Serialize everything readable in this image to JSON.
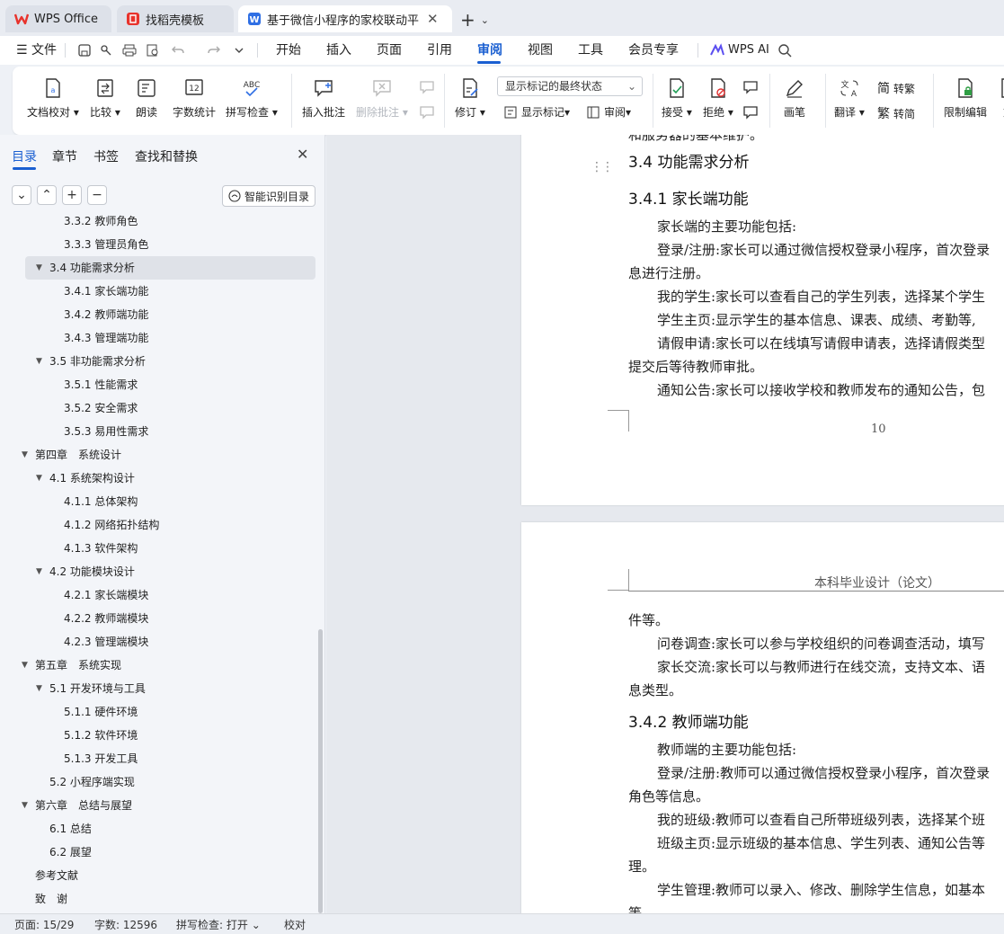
{
  "tabs": [
    {
      "label": "WPS Office",
      "icon": "wps-logo-icon"
    },
    {
      "label": "找稻壳模板",
      "icon": "docer-icon"
    },
    {
      "label": "基于微信小程序的家校联动平台",
      "icon": "word-doc-icon"
    }
  ],
  "menu": {
    "file_label": "文件",
    "items": [
      "开始",
      "插入",
      "页面",
      "引用",
      "审阅",
      "视图",
      "工具",
      "会员专享"
    ],
    "active": "审阅",
    "wps_ai_label": "WPS AI"
  },
  "ribbon": {
    "doc_check": "文档校对",
    "compare": "比较",
    "read_aloud": "朗读",
    "word_count": "字数统计",
    "spell_check": "拼写检查",
    "insert_comment": "插入批注",
    "delete_comment": "删除批注",
    "track_changes": "修订",
    "markup_state": "显示标记的最终状态",
    "show_markup": "显示标记",
    "review": "审阅",
    "accept": "接受",
    "reject": "拒绝",
    "ink": "画笔",
    "translate": "翻译",
    "to_traditional": "转繁",
    "to_simplified": "转简",
    "restrict_edit": "限制编辑",
    "cut_off": "文"
  },
  "nav": {
    "tabs": [
      "目录",
      "章节",
      "书签",
      "查找和替换"
    ],
    "smart_btn": "智能识别目录",
    "toc": [
      {
        "text": "3.3.2 教师角色",
        "level": 3
      },
      {
        "text": "3.3.3 管理员角色",
        "level": 3
      },
      {
        "text": "3.4 功能需求分析",
        "level": 2,
        "expanded": true,
        "selected": true
      },
      {
        "text": "3.4.1 家长端功能",
        "level": 3
      },
      {
        "text": "3.4.2 教师端功能",
        "level": 3
      },
      {
        "text": "3.4.3 管理端功能",
        "level": 3
      },
      {
        "text": "3.5 非功能需求分析",
        "level": 2,
        "expanded": true
      },
      {
        "text": "3.5.1 性能需求",
        "level": 3
      },
      {
        "text": "3.5.2 安全需求",
        "level": 3
      },
      {
        "text": "3.5.3 易用性需求",
        "level": 3
      },
      {
        "text": "第四章　系统设计",
        "level": 1,
        "expanded": true
      },
      {
        "text": "4.1 系统架构设计",
        "level": 2,
        "expanded": true
      },
      {
        "text": "4.1.1 总体架构",
        "level": 3
      },
      {
        "text": "4.1.2 网络拓扑结构",
        "level": 3
      },
      {
        "text": "4.1.3 软件架构",
        "level": 3
      },
      {
        "text": "4.2 功能模块设计",
        "level": 2,
        "expanded": true
      },
      {
        "text": "4.2.1 家长端模块",
        "level": 3
      },
      {
        "text": "4.2.2 教师端模块",
        "level": 3
      },
      {
        "text": "4.2.3 管理端模块",
        "level": 3
      },
      {
        "text": "第五章　系统实现",
        "level": 1,
        "expanded": true
      },
      {
        "text": "5.1 开发环境与工具",
        "level": 2,
        "expanded": true
      },
      {
        "text": "5.1.1 硬件环境",
        "level": 3
      },
      {
        "text": "5.1.2 软件环境",
        "level": 3
      },
      {
        "text": "5.1.3 开发工具",
        "level": 3
      },
      {
        "text": "5.2 小程序端实现",
        "level": 2
      },
      {
        "text": "第六章　总结与展望",
        "level": 1,
        "expanded": true
      },
      {
        "text": "6.1 总结",
        "level": 2
      },
      {
        "text": "6.2 展望",
        "level": 2
      },
      {
        "text": "参考文献",
        "level": 1
      },
      {
        "text": "致　谢",
        "level": 1
      }
    ]
  },
  "page1": {
    "top_line": "和服务器的基本维护。",
    "h_34": "3.4 功能需求分析",
    "h_341": "3.4.1 家长端功能",
    "lines": [
      "家长端的主要功能包括:",
      "登录/注册:家长可以通过微信授权登录小程序，首次登录",
      "息进行注册。",
      "我的学生:家长可以查看自己的学生列表，选择某个学生",
      "学生主页:显示学生的基本信息、课表、成绩、考勤等,",
      "请假申请:家长可以在线填写请假申请表，选择请假类型",
      "提交后等待教师审批。",
      "通知公告:家长可以接收学校和教师发布的通知公告，包"
    ],
    "page_number": "10"
  },
  "page2": {
    "header": "本科毕业设计（论文）",
    "lines_a": [
      "件等。",
      "问卷调查:家长可以参与学校组织的问卷调查活动，填写",
      "家长交流:家长可以与教师进行在线交流，支持文本、语",
      "息类型。"
    ],
    "h_342": "3.4.2 教师端功能",
    "lines_b": [
      "教师端的主要功能包括:",
      "登录/注册:教师可以通过微信授权登录小程序，首次登录",
      "角色等信息。",
      "我的班级:教师可以查看自己所带班级列表，选择某个班",
      "班级主页:显示班级的基本信息、学生列表、通知公告等",
      "理。",
      "学生管理:教师可以录入、修改、删除学生信息，如基本",
      "等"
    ]
  },
  "status": {
    "page": "页面: 15/29",
    "words": "字数: 12596",
    "spell": "拼写检查: 打开",
    "proof": "校对"
  }
}
